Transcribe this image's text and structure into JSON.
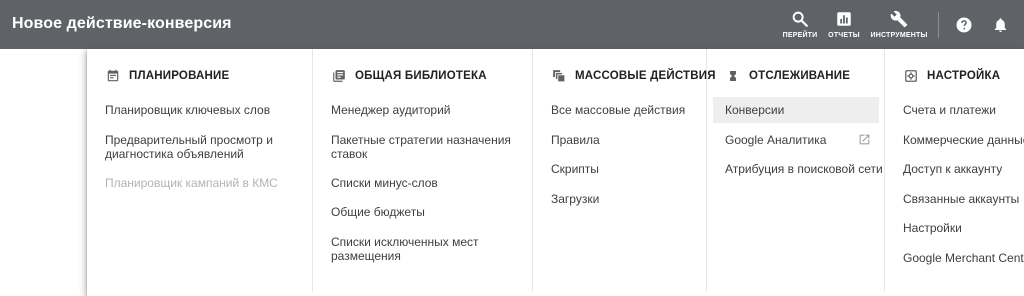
{
  "header": {
    "title": "Новое действие-конверсия",
    "tools": {
      "search_label": "ПЕРЕЙТИ",
      "reports_label": "ОТЧЕТЫ",
      "tools_label": "ИНСТРУМЕНТЫ"
    },
    "icons": [
      "search-icon",
      "bar-chart-icon",
      "wrench-icon",
      "help-icon",
      "bell-icon"
    ]
  },
  "menu": {
    "planning": {
      "title": "ПЛАНИРОВАНИЕ",
      "icon": "calendar-icon",
      "items": [
        "Планировщик ключевых слов",
        "Предварительный просмотр и",
        "диагностика объявлений",
        "Планировщик кампаний в КМС"
      ]
    },
    "library": {
      "title": "ОБЩАЯ БИБЛИОТЕКА",
      "icon": "library-icon",
      "items": [
        "Менеджер аудиторий",
        "Пакетные стратегии назначения",
        "ставок",
        "Списки минус-слов",
        "Общие бюджеты",
        "Списки исключенных мест",
        "размещения"
      ]
    },
    "bulk": {
      "title": "МАССОВЫЕ ДЕЙСТВИЯ",
      "icon": "bulk-actions-icon",
      "items": [
        "Все массовые действия",
        "Правила",
        "Скрипты",
        "Загрузки"
      ]
    },
    "tracking": {
      "title": "ОТСЛЕЖИВАНИЕ",
      "icon": "hourglass-icon",
      "items": [
        "Конверсии",
        "Google Аналитика",
        "Атрибуция в поисковой сети"
      ]
    },
    "setup": {
      "title": "НАСТРОЙКА",
      "icon": "settings-icon",
      "items": [
        "Счета и платежи",
        "Коммерческие данные",
        "Доступ к аккаунту",
        "Связанные аккаунты",
        "Настройки",
        "Google Merchant Center"
      ]
    }
  },
  "colors": {
    "header_bg": "#5f6368",
    "text": "#3c4043",
    "disabled_text": "#b0b3b8",
    "selected_bg": "#eeeeee"
  }
}
